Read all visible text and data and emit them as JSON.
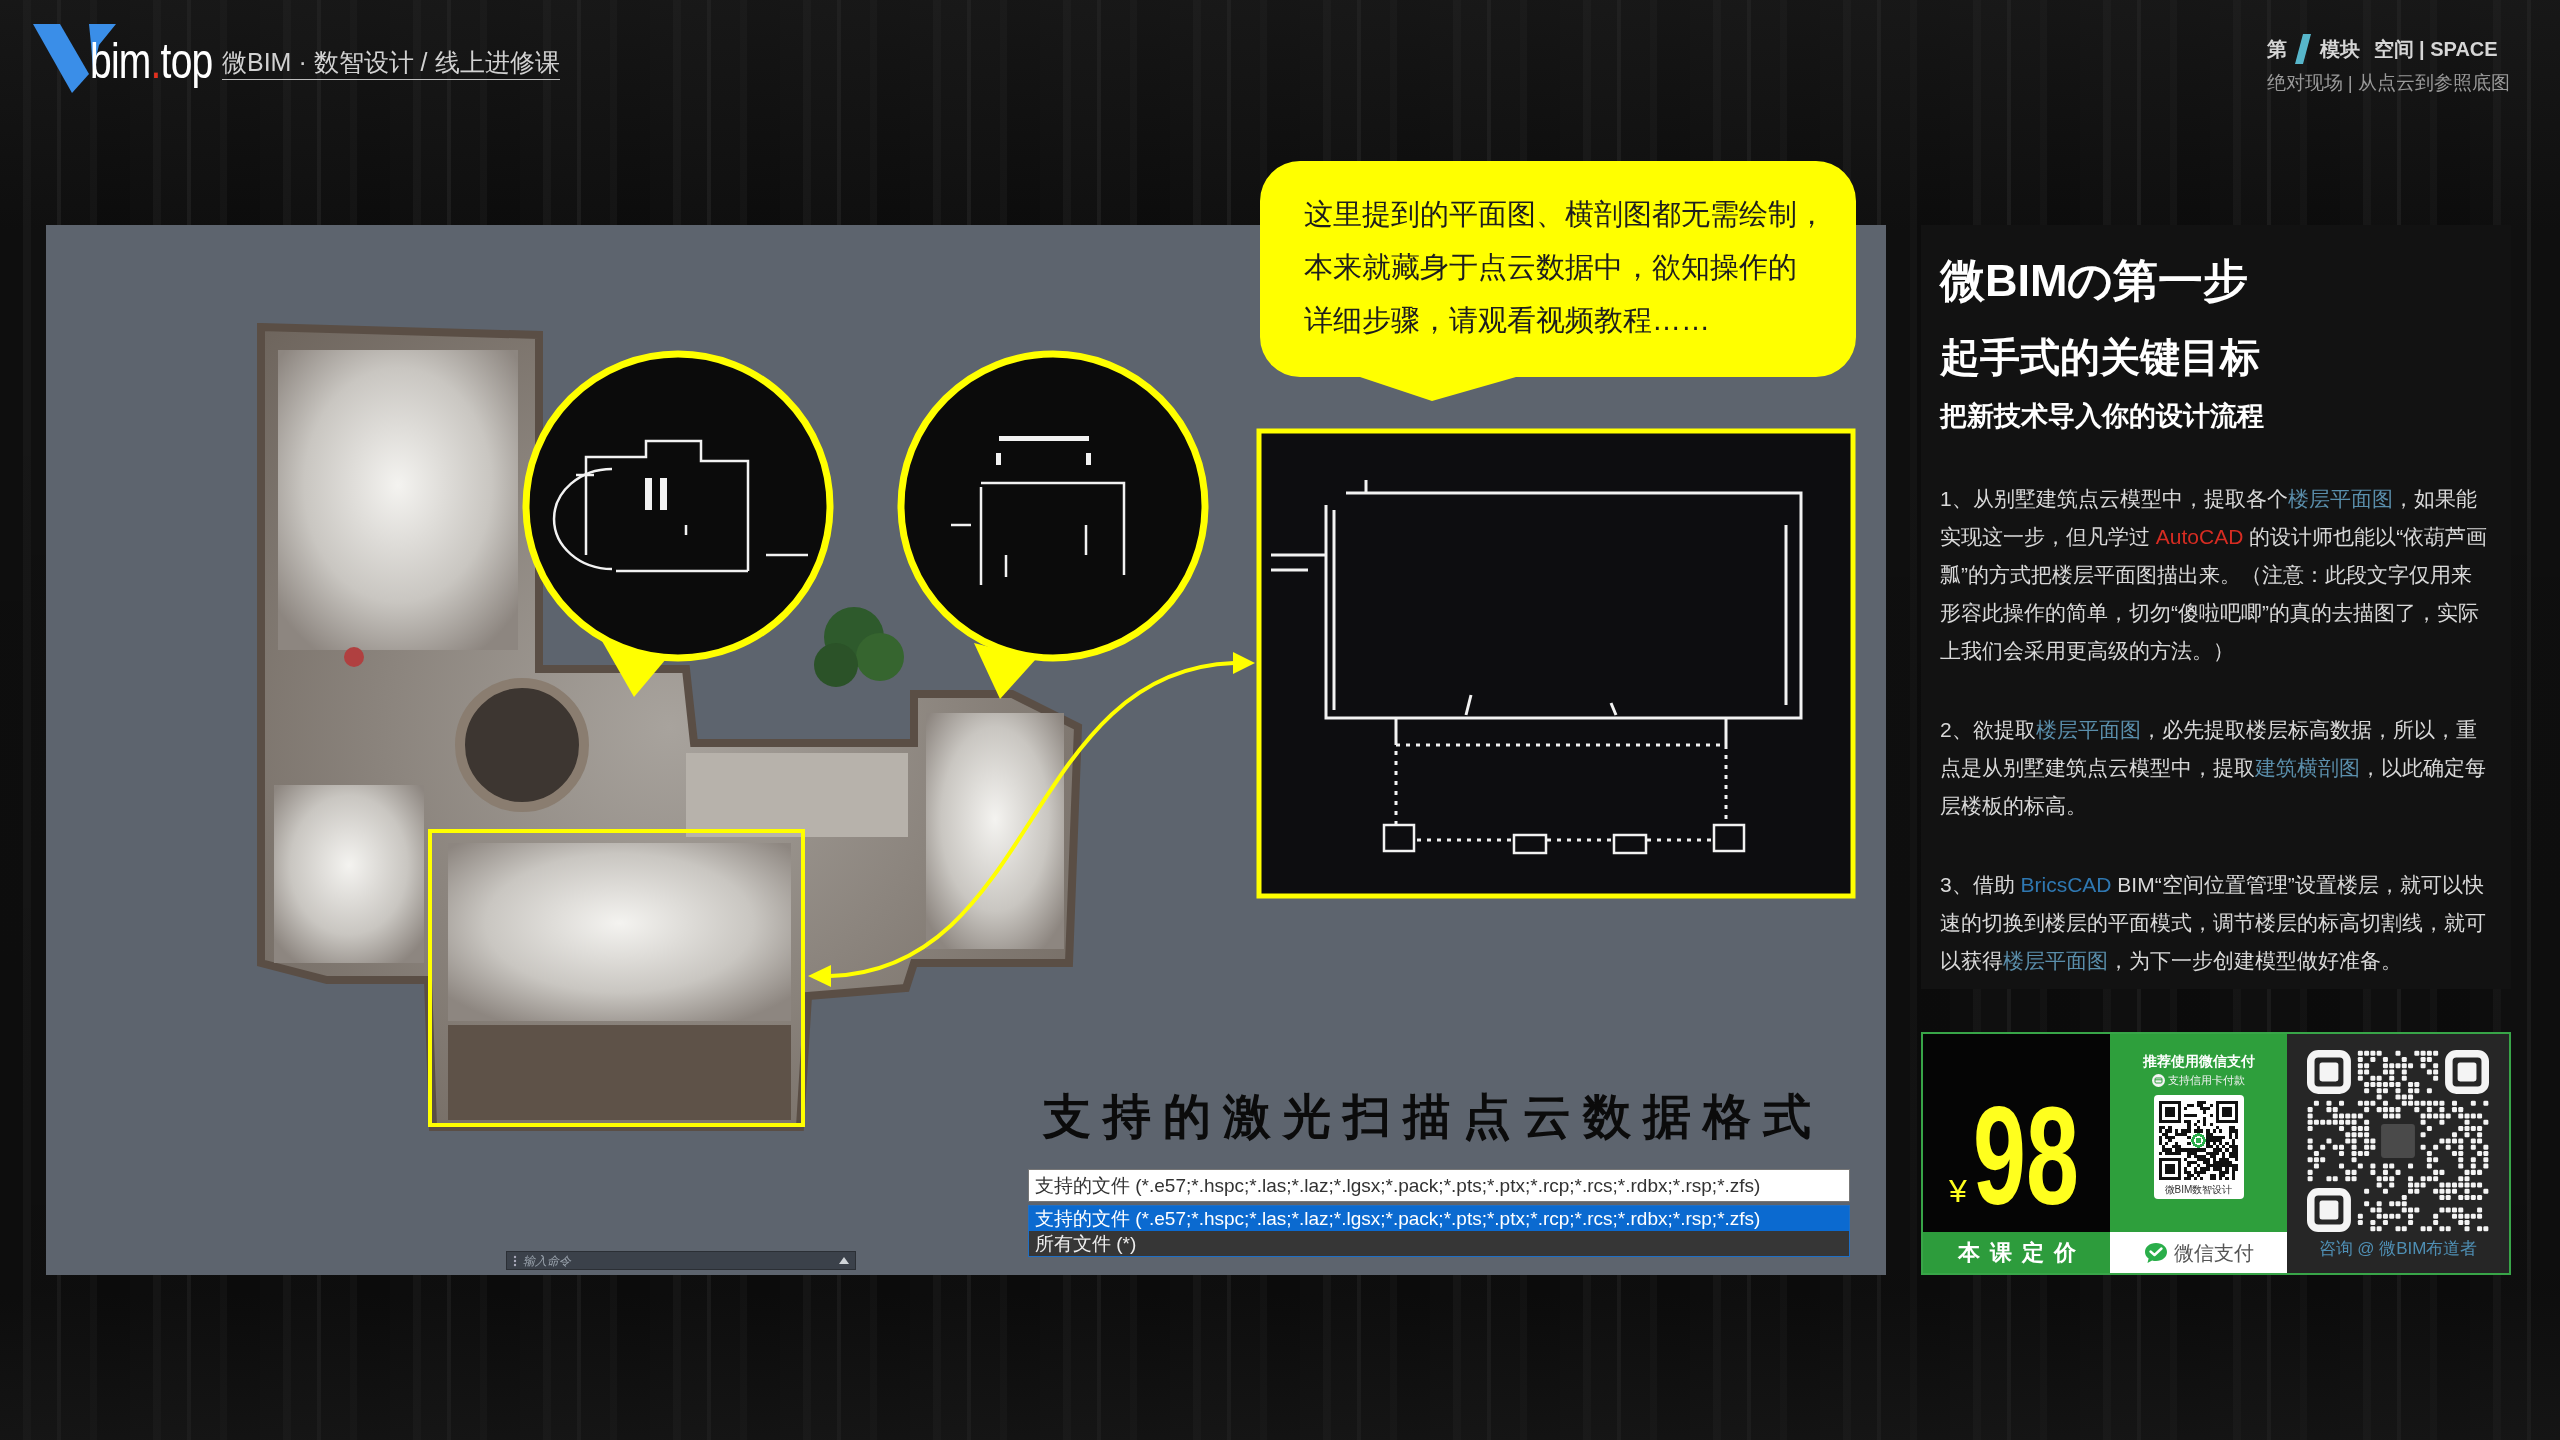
{
  "header": {
    "logo": {
      "parts": [
        {
          "text": "bim",
          "kind": "plain"
        },
        {
          "text": ".",
          "kind": "accent"
        },
        {
          "text": "top",
          "kind": "plain"
        }
      ]
    },
    "tagline": "微BIM · 数智设计 / 线上进修课"
  },
  "module": {
    "prefix": "第",
    "label": "模块",
    "title": "空间 | SPACE",
    "subtitle": "绝对现场 | 从点云到参照底图"
  },
  "scene": {
    "callout_lines": [
      "这里提到的平面图、横剖图都无需绘制，",
      "本来就藏身于点云数据中，欲知操作的",
      "详细步骤，请观看视频教程……"
    ],
    "heading": "支持的激光扫描点云数据格式",
    "file_filter": {
      "value": "支持的文件 (*.e57;*.hspc;*.las;*.laz;*.lgsx;*.pack;*.pts;*.ptx;*.rcp;*.rcs;*.rdbx;*.rsp;*.zfs)"
    },
    "file_types": [
      {
        "label": "支持的文件 (*.e57;*.hspc;*.las;*.laz;*.lgsx;*.pack;*.pts;*.ptx;*.rcp;*.rcs;*.rdbx;*.rsp;*.zfs)",
        "selected": true
      },
      {
        "label": "所有文件 (*)",
        "selected": false
      }
    ],
    "command_line": {
      "placeholder": "输入命令"
    }
  },
  "info_panel": {
    "title": "微BIMの第一步",
    "subtitle": "起手式的关键目标",
    "tagline": "把新技术导入你的设计流程",
    "paragraphs": [
      {
        "segments": [
          {
            "text": "1、从别墅建筑点云模型中，提取各个",
            "kind": "plain"
          },
          {
            "text": "楼层平面图",
            "kind": "term"
          },
          {
            "text": "，如果能实现这一步，但凡学过 ",
            "kind": "plain"
          },
          {
            "text": "AutoCAD",
            "kind": "highlight"
          },
          {
            "text": " 的设计师也能以“依葫芦画瓢”的方式把楼层平面图描出来。（注意：此段文字仅用来形容此操作的简单，切勿“傻啦吧唧”的真的去描图了，实际上我们会采用更高级的方法。）",
            "kind": "plain"
          }
        ]
      },
      {
        "segments": [
          {
            "text": "2、欲提取",
            "kind": "plain"
          },
          {
            "text": "楼层平面图",
            "kind": "term"
          },
          {
            "text": "，必先提取楼层标高数据，所以，重点是从别墅建筑点云模型中，提取",
            "kind": "plain"
          },
          {
            "text": "建筑横剖图",
            "kind": "term"
          },
          {
            "text": "，以此确定每层楼板的标高。",
            "kind": "plain"
          }
        ]
      },
      {
        "segments": [
          {
            "text": "3、借助 ",
            "kind": "plain"
          },
          {
            "text": "BricsCAD",
            "kind": "product"
          },
          {
            "text": " BIM“空间位置管理”设置楼层，就可以快速的切换到楼层的平面模式，调节楼层的标高切割线，就可以获得",
            "kind": "plain"
          },
          {
            "text": "楼层平面图",
            "kind": "term"
          },
          {
            "text": "，为下一步创建模型做好准备。",
            "kind": "plain"
          }
        ]
      }
    ]
  },
  "pricing": {
    "currency": "¥",
    "amount": "98",
    "label": "本课定价"
  },
  "payment": {
    "heading": "推荐使用微信支付",
    "note": "支持信用卡付款",
    "qr_caption": "微BIM数智设计",
    "method": "微信支付"
  },
  "contact": {
    "caption": "咨询 @ 微BIM布道者"
  }
}
